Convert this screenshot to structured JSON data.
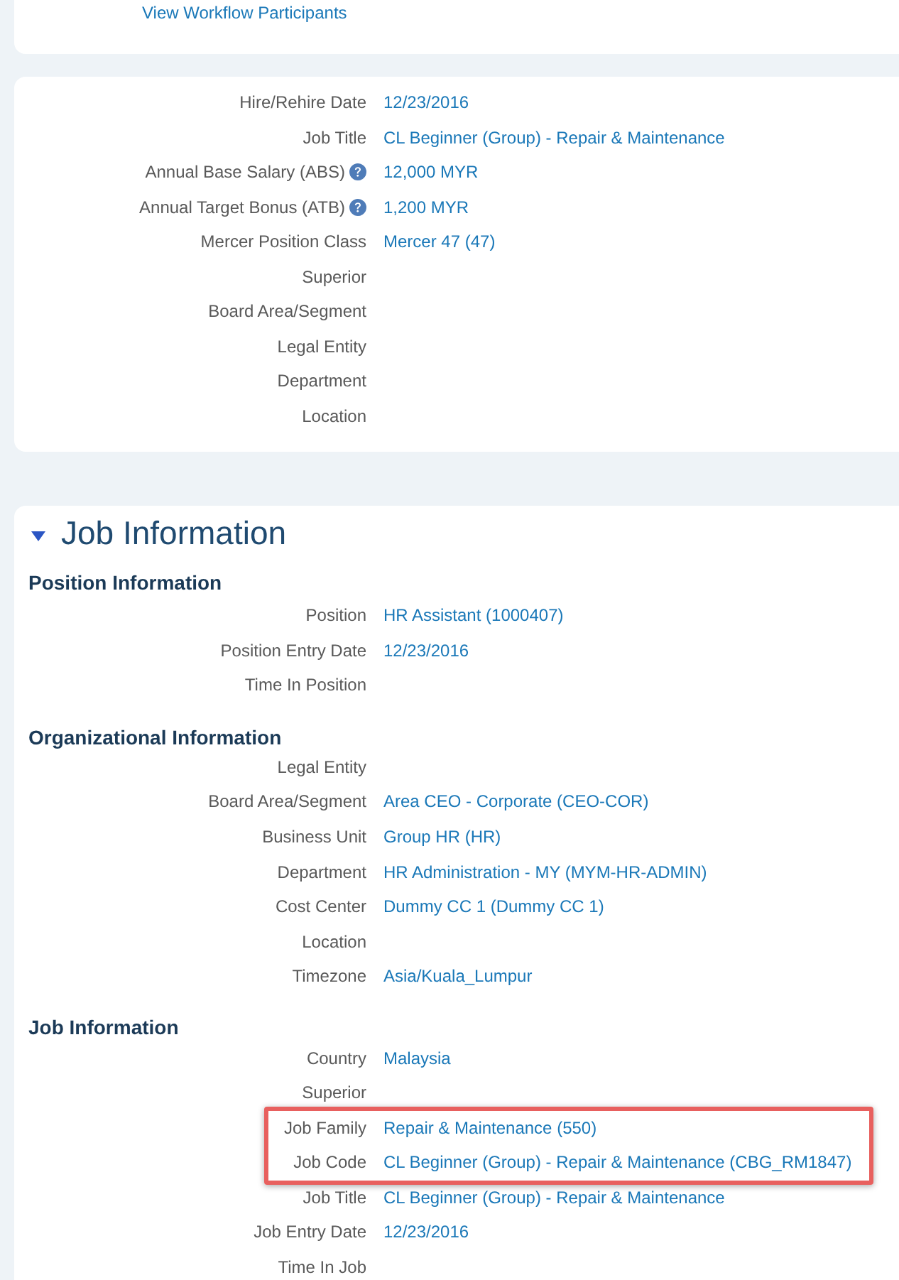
{
  "workflow_card": {
    "link": "View Workflow Participants"
  },
  "summary_card": {
    "rows": [
      {
        "label": "Hire/Rehire Date",
        "value": "12/23/2016"
      },
      {
        "label": "Job Title",
        "value": "CL Beginner (Group) - Repair & Maintenance"
      },
      {
        "label": "Annual Base Salary (ABS)",
        "help": true,
        "value": "12,000 MYR"
      },
      {
        "label": "Annual Target Bonus (ATB)",
        "help": true,
        "value": "1,200 MYR"
      },
      {
        "label": "Mercer Position Class",
        "value": "Mercer 47 (47)"
      },
      {
        "label": "Superior"
      },
      {
        "label": "Board Area/Segment"
      },
      {
        "label": "Legal Entity"
      },
      {
        "label": "Department"
      },
      {
        "label": "Location"
      }
    ]
  },
  "job_information": {
    "title": "Job Information",
    "expanded": true,
    "sections": [
      {
        "title": "Position Information",
        "rows": [
          {
            "label": "Position",
            "value": "HR Assistant (1000407)",
            "highlighted": false
          },
          {
            "label": "Position Entry Date",
            "value": "12/23/2016",
            "highlighted": false
          },
          {
            "label": "Time In Position",
            "highlighted": false
          }
        ]
      },
      {
        "title": "Organizational Information",
        "rows": [
          {
            "label": "Legal Entity",
            "highlighted": false
          },
          {
            "label": "Board Area/Segment",
            "value": "Area CEO - Corporate (CEO-COR)",
            "highlighted": false
          },
          {
            "label": "Business Unit",
            "value": "Group HR (HR)",
            "highlighted": false
          },
          {
            "label": "Department",
            "value": "HR Administration - MY (MYM-HR-ADMIN)",
            "highlighted": false
          },
          {
            "label": "Cost Center",
            "value": "Dummy CC 1 (Dummy CC 1)",
            "highlighted": false
          },
          {
            "label": "Location",
            "highlighted": false
          },
          {
            "label": "Timezone",
            "value": "Asia/Kuala_Lumpur",
            "highlighted": false
          }
        ]
      },
      {
        "title": "Job Information",
        "rows": [
          {
            "label": "Country",
            "value": "Malaysia",
            "highlighted": false
          },
          {
            "label": "Superior",
            "highlighted": false
          },
          {
            "label": "Job Family",
            "value": "Repair & Maintenance (550)",
            "highlighted": true
          },
          {
            "label": "Job Code",
            "value": "CL Beginner (Group) - Repair & Maintenance (CBG_RM1847)",
            "highlighted": true
          },
          {
            "label": "Job Title",
            "value": "CL Beginner (Group) - Repair & Maintenance",
            "highlighted": false
          },
          {
            "label": "Job Entry Date",
            "value": "12/23/2016",
            "highlighted": false
          },
          {
            "label": "Time In Job",
            "highlighted": false
          }
        ]
      }
    ]
  }
}
